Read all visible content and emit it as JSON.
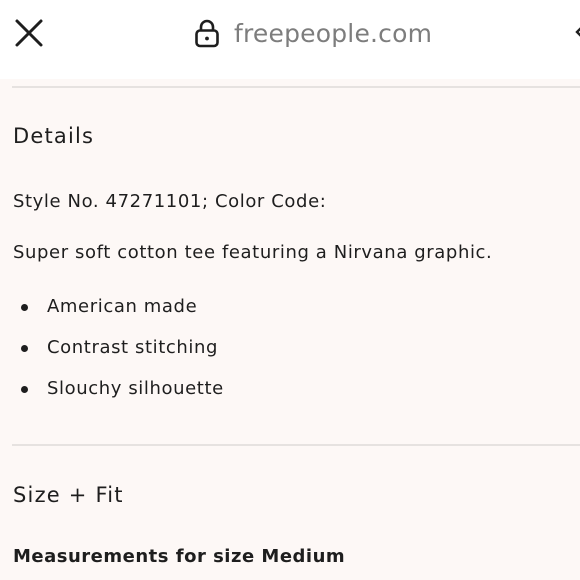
{
  "browser": {
    "url": "freepeople.com",
    "close_icon": "close-icon",
    "lock_icon": "lock-icon"
  },
  "details": {
    "title": "Details",
    "style_line": "Style No. 47271101; Color Code:",
    "description": "Super soft cotton tee featuring a Nirvana graphic.",
    "bullets": [
      "American made",
      "Contrast stitching",
      "Slouchy silhouette"
    ]
  },
  "size_fit": {
    "title": "Size + Fit",
    "measurements_heading": "Measurements for size Medium"
  }
}
